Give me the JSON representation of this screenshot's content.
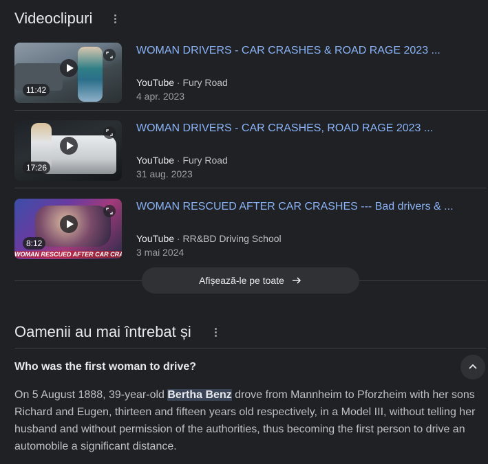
{
  "videos_section": {
    "title": "Videoclipuri",
    "items": [
      {
        "title": "WOMAN DRIVERS - CAR CRASHES & ROAD RAGE 2023 ...",
        "duration": "11:42",
        "platform": "YouTube",
        "separator": "·",
        "channel": "Fury Road",
        "date": "4 apr. 2023"
      },
      {
        "title": "WOMAN DRIVERS - CAR CRASHES, ROAD RAGE 2023 ...",
        "duration": "17:26",
        "platform": "YouTube",
        "separator": "·",
        "channel": "Fury Road",
        "date": "31 aug. 2023"
      },
      {
        "title": "WOMAN RESCUED AFTER CAR CRASHES --- Bad drivers & ...",
        "duration": "8:12",
        "platform": "YouTube",
        "separator": "·",
        "channel": "RR&BD Driving School",
        "date": "3 mai 2024",
        "thumb_caption": "WOMAN RESCUED AFTER CAR CRASHES"
      }
    ],
    "show_all_label": "Afișează-le pe toate"
  },
  "paa_section": {
    "title": "Oamenii au mai întrebat și",
    "question": "Who was the first woman to drive?",
    "answer_before": "On 5 August 1888, 39-year-old ",
    "answer_highlight": "Bertha Benz",
    "answer_after": " drove from Mannheim to Pforzheim with her sons Richard and Eugen, thirteen and fifteen years old respectively, in a Model III, without telling her husband and without permission of the authorities, thus becoming the first person to drive an automobile a significant distance."
  },
  "colors": {
    "background": "#202124",
    "link": "#8ab4f8",
    "highlight": "#394457"
  }
}
